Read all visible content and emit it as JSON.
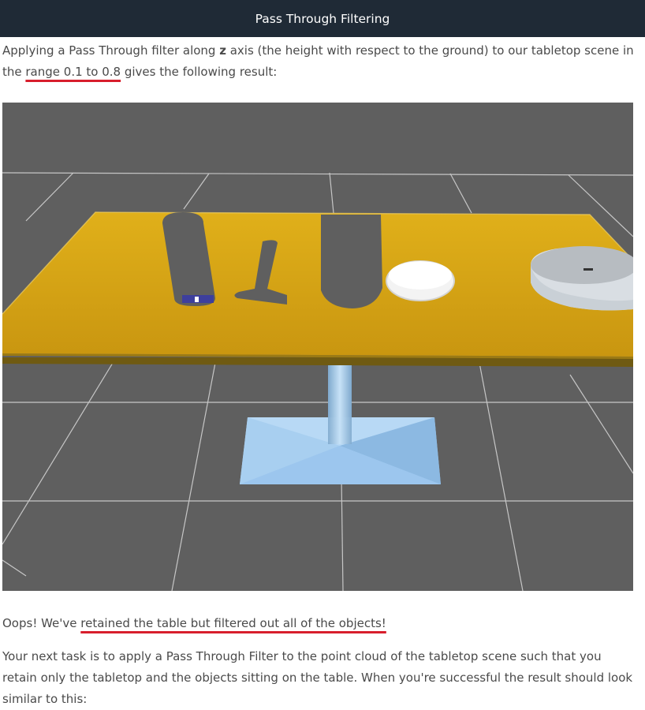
{
  "header": {
    "title": "Pass Through Filtering"
  },
  "intro": {
    "part1": "Applying a Pass Through filter along ",
    "bold": "z",
    "part2": " axis (the height with respect to the ground) to our tabletop scene in the ",
    "highlight": "range 0.1 to 0.8",
    "part3": " gives the following result:"
  },
  "figure": {
    "name": "rendered tabletop scene with objects filtered out"
  },
  "oops": {
    "part1": "Oops! We've ",
    "highlight": "retained the table but filtered out all of the objects!"
  },
  "task": {
    "text": "Your next task is to apply a Pass Through Filter to the point cloud of the tabletop scene such that you retain only the tabletop and the objects sitting on the table. When you're successful the result should look similar to this:"
  },
  "colors": {
    "topbar": "#1f2a36",
    "underline": "#d81e2c",
    "table": "#d9a514",
    "background3d": "#5f5f5f",
    "pedestal": "#9cc8ee"
  }
}
